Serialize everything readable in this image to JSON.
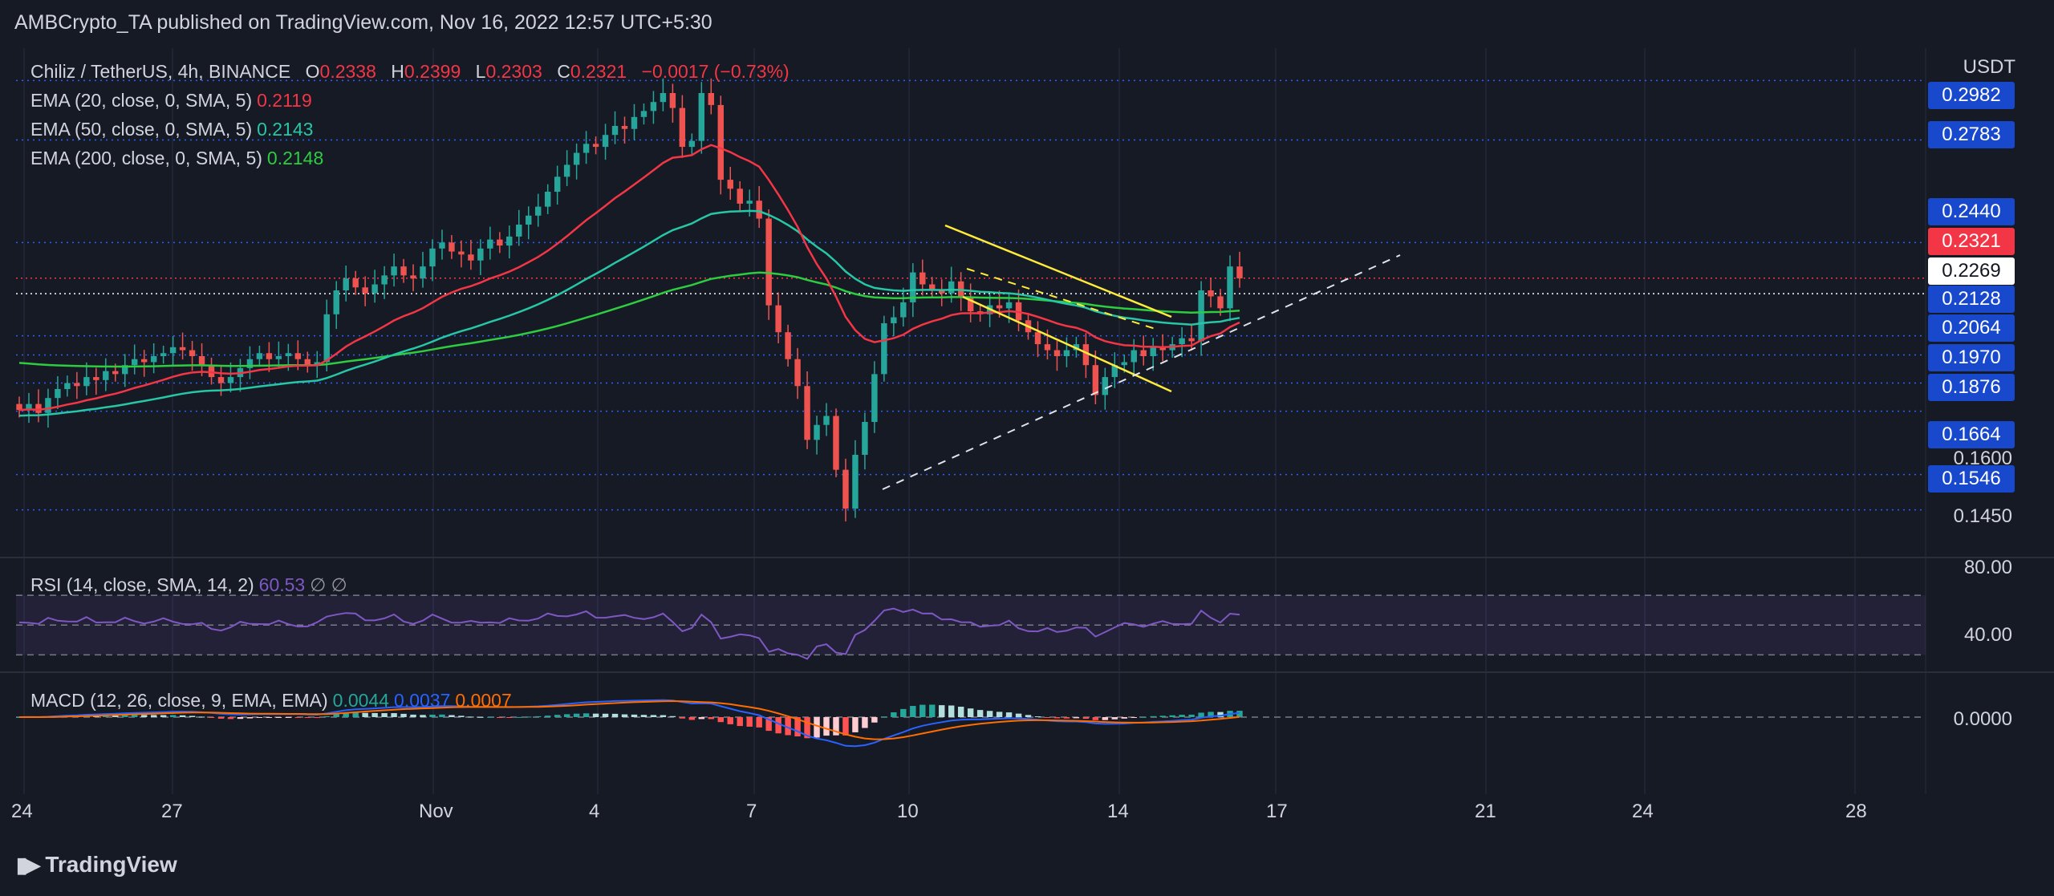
{
  "header": {
    "publisher": "AMBCrypto_TA published on TradingView.com, Nov 16, 2022 12:57 UTC+5:30"
  },
  "legend": {
    "symbol": "Chiliz / TetherUS, 4h, BINANCE",
    "ohlc": {
      "o_label": "O",
      "o": "0.2338",
      "h_label": "H",
      "h": "0.2399",
      "l_label": "L",
      "l": "0.2303",
      "c_label": "C",
      "c": "0.2321",
      "change": "−0.0017 (−0.73%)"
    },
    "ema": [
      {
        "label": "EMA (20, close, 0, SMA, 5)",
        "value": "0.2119",
        "color": "#f23645"
      },
      {
        "label": "EMA (50, close, 0, SMA, 5)",
        "value": "0.2143",
        "color": "#26c6a6"
      },
      {
        "label": "EMA (200, close, 0, SMA, 5)",
        "value": "0.2148",
        "color": "#2ecc40"
      }
    ],
    "rsi": {
      "label": "RSI (14, close, SMA, 14, 2)",
      "value": "60.53",
      "extra": "∅ ∅",
      "color": "#7e57c2"
    },
    "macd": {
      "label": "MACD (12, 26, close, 9, EMA, EMA)",
      "hist": "0.0044",
      "macd": "0.0037",
      "signal": "0.0007"
    }
  },
  "price_axis": {
    "currency": "USDT",
    "tags": [
      {
        "value": "0.2982",
        "color": "#1848cc"
      },
      {
        "value": "0.2783",
        "color": "#1848cc"
      },
      {
        "value": "0.2440",
        "color": "#1848cc"
      },
      {
        "value": "0.2321",
        "color": "#f23645"
      },
      {
        "value": "0.2269",
        "color": "#ffffff",
        "text_color": "#131722"
      },
      {
        "value": "0.2128",
        "color": "#1848cc"
      },
      {
        "value": "0.2064",
        "color": "#1848cc"
      },
      {
        "value": "0.1970",
        "color": "#1848cc"
      },
      {
        "value": "0.1876",
        "color": "#1848cc"
      },
      {
        "value": "0.1664",
        "color": "#1848cc"
      },
      {
        "value": "0.1546",
        "color": "#1848cc"
      }
    ],
    "plain_labels": [
      "0.1600",
      "0.1450"
    ],
    "rsi_labels": [
      "80.00",
      "40.00"
    ],
    "macd_labels": [
      "0.0000"
    ]
  },
  "time_axis": {
    "labels": [
      "24",
      "27",
      "Nov",
      "4",
      "7",
      "10",
      "14",
      "17",
      "21",
      "24",
      "28"
    ]
  },
  "footer": {
    "brand": "TradingView"
  },
  "chart_data": {
    "type": "candlestick",
    "title": "Chiliz / TetherUS, 4h, BINANCE",
    "ylim": [
      0.14,
      0.305
    ],
    "support_resistance_levels": [
      0.2982,
      0.2783,
      0.244,
      0.2128,
      0.2064,
      0.197,
      0.1876,
      0.1664,
      0.1546
    ],
    "close_series": [
      0.188,
      0.19,
      0.187,
      0.192,
      0.195,
      0.197,
      0.196,
      0.199,
      0.198,
      0.201,
      0.2,
      0.203,
      0.205,
      0.204,
      0.206,
      0.207,
      0.209,
      0.208,
      0.206,
      0.203,
      0.199,
      0.197,
      0.199,
      0.202,
      0.205,
      0.207,
      0.205,
      0.206,
      0.207,
      0.205,
      0.203,
      0.204,
      0.22,
      0.228,
      0.232,
      0.229,
      0.227,
      0.23,
      0.233,
      0.236,
      0.233,
      0.232,
      0.236,
      0.242,
      0.244,
      0.241,
      0.24,
      0.238,
      0.242,
      0.245,
      0.243,
      0.246,
      0.25,
      0.253,
      0.256,
      0.261,
      0.266,
      0.27,
      0.274,
      0.277,
      0.276,
      0.28,
      0.283,
      0.282,
      0.286,
      0.288,
      0.291,
      0.294,
      0.289,
      0.276,
      0.278,
      0.294,
      0.29,
      0.265,
      0.262,
      0.257,
      0.258,
      0.252,
      0.223,
      0.214,
      0.205,
      0.196,
      0.178,
      0.183,
      0.186,
      0.168,
      0.155,
      0.173,
      0.184,
      0.2,
      0.217,
      0.219,
      0.224,
      0.234,
      0.23,
      0.228,
      0.227,
      0.231,
      0.226,
      0.221,
      0.22,
      0.223,
      0.222,
      0.224,
      0.218,
      0.214,
      0.21,
      0.208,
      0.206,
      0.208,
      0.21,
      0.203,
      0.193,
      0.199,
      0.203,
      0.204,
      0.208,
      0.206,
      0.209,
      0.208,
      0.21,
      0.212,
      0.211,
      0.228,
      0.226,
      0.222,
      0.236,
      0.232
    ]
  }
}
